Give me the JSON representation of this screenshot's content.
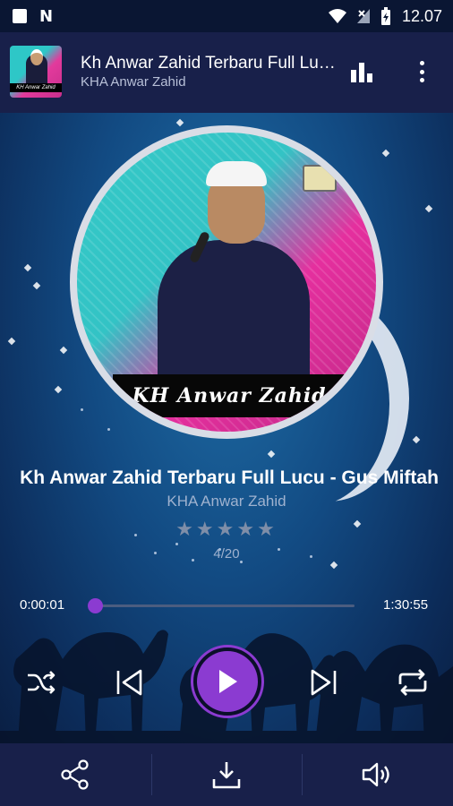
{
  "status_bar": {
    "time": "12.07"
  },
  "now_playing_header": {
    "title": "Kh Anwar Zahid Terbaru Full Lucu - Gus Miftah",
    "artist": "KHA Anwar Zahid",
    "thumbnail_caption": "KH Anwar Zahid"
  },
  "album_art": {
    "banner_text": "KH Anwar Zahid"
  },
  "track": {
    "title": "Kh Anwar Zahid Terbaru Full Lucu - Gus Miftah",
    "artist": "KHA Anwar Zahid",
    "rating_stars": 0,
    "rating_max": 5,
    "rating_display": "★★★★★",
    "position_label": "4/20"
  },
  "progress": {
    "current_time": "0:00:01",
    "total_time": "1:30:55",
    "fraction": 0.0
  },
  "controls": {
    "shuffle": "shuffle-icon",
    "previous": "skip-previous-icon",
    "play": "play-icon",
    "next": "skip-next-icon",
    "repeat": "repeat-icon"
  },
  "bottom_actions": [
    "share-icon",
    "download-icon",
    "volume-icon"
  ],
  "colors": {
    "accent": "#8b3bd1",
    "bar_bg": "#18204a",
    "background": "#124a82"
  }
}
